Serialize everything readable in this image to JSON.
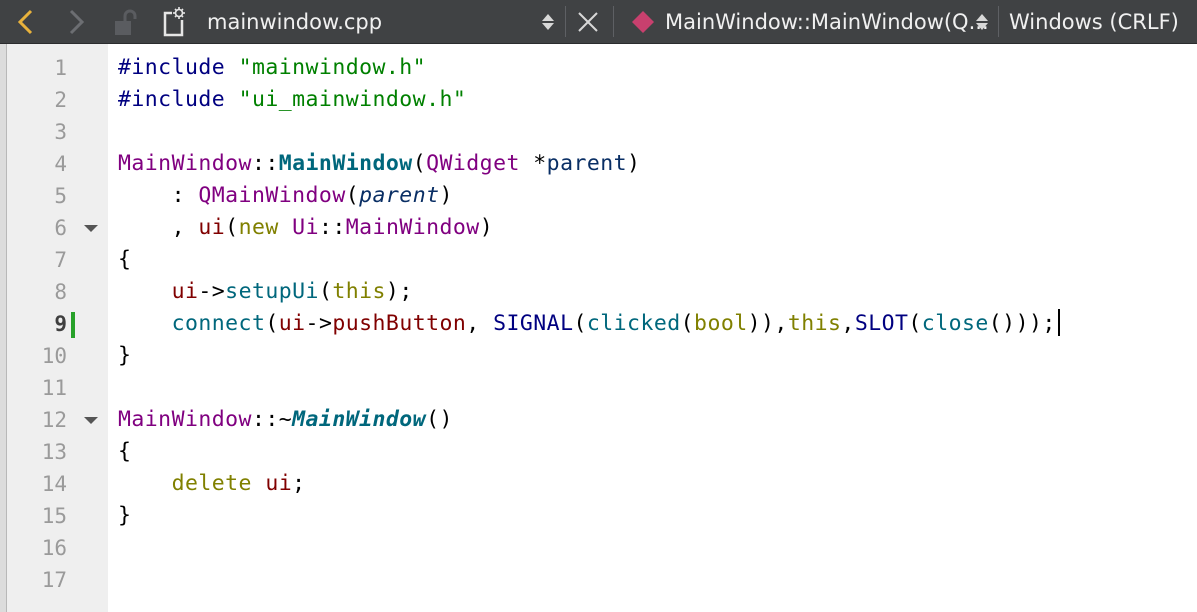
{
  "toolbar": {
    "file_name": "mainwindow.cpp",
    "symbol": "MainWindow::MainWindow(Q...",
    "line_endings": "Windows (CRLF)",
    "colors": {
      "background": "#404244",
      "symbol_icon": "#c8406e"
    },
    "icons": [
      "back-arrow-icon",
      "forward-arrow-icon",
      "lock-icon",
      "file-icon",
      "select-arrows-icon",
      "close-icon",
      "symbol-icon",
      "select-arrows-icon"
    ]
  },
  "editor": {
    "current_line": "9",
    "line_numbers": [
      "1",
      "2",
      "3",
      "4",
      "5",
      "6",
      "7",
      "8",
      "9",
      "10",
      "11",
      "12",
      "13",
      "14",
      "15",
      "16",
      "17"
    ],
    "fold_markers": [
      "6",
      "12"
    ],
    "lines": [
      [
        [
          "pp",
          "#include"
        ],
        [
          "op",
          " "
        ],
        [
          "str",
          "\"mainwindow.h\""
        ]
      ],
      [
        [
          "pp",
          "#include"
        ],
        [
          "op",
          " "
        ],
        [
          "str",
          "\"ui_mainwindow.h\""
        ]
      ],
      [],
      [
        [
          "type",
          "MainWindow"
        ],
        [
          "op",
          "::"
        ],
        [
          "decl",
          "MainWindow"
        ],
        [
          "op",
          "("
        ],
        [
          "type",
          "QWidget"
        ],
        [
          "op",
          " *"
        ],
        [
          "param",
          "parent"
        ],
        [
          "op",
          ")"
        ]
      ],
      [
        [
          "op",
          "    : "
        ],
        [
          "type",
          "QMainWindow"
        ],
        [
          "op",
          "("
        ],
        [
          "param-it",
          "parent"
        ],
        [
          "op",
          ")"
        ]
      ],
      [
        [
          "op",
          "    , "
        ],
        [
          "field",
          "ui"
        ],
        [
          "op",
          "("
        ],
        [
          "kw",
          "new"
        ],
        [
          "op",
          " "
        ],
        [
          "type",
          "Ui"
        ],
        [
          "op",
          "::"
        ],
        [
          "type",
          "MainWindow"
        ],
        [
          "op",
          ")"
        ]
      ],
      [
        [
          "op",
          "{"
        ]
      ],
      [
        [
          "op",
          "    "
        ],
        [
          "field",
          "ui"
        ],
        [
          "op",
          "->"
        ],
        [
          "func",
          "setupUi"
        ],
        [
          "op",
          "("
        ],
        [
          "kw",
          "this"
        ],
        [
          "op",
          ");"
        ]
      ],
      [
        [
          "op",
          "    "
        ],
        [
          "func",
          "connect"
        ],
        [
          "op",
          "("
        ],
        [
          "field",
          "ui"
        ],
        [
          "op",
          "->"
        ],
        [
          "field",
          "pushButton"
        ],
        [
          "op",
          ", "
        ],
        [
          "macro",
          "SIGNAL"
        ],
        [
          "op",
          "("
        ],
        [
          "func",
          "clicked"
        ],
        [
          "op",
          "("
        ],
        [
          "kw",
          "bool"
        ],
        [
          "op",
          "))"
        ],
        [
          "op",
          ","
        ],
        [
          "kw",
          "this"
        ],
        [
          "op",
          ","
        ],
        [
          "macro",
          "SLOT"
        ],
        [
          "op",
          "("
        ],
        [
          "func",
          "close"
        ],
        [
          "op",
          "()));"
        ]
      ],
      [
        [
          "op",
          "}"
        ]
      ],
      [],
      [
        [
          "type",
          "MainWindow"
        ],
        [
          "op",
          "::~"
        ],
        [
          "decl-it",
          "MainWindow"
        ],
        [
          "op",
          "()"
        ]
      ],
      [
        [
          "op",
          "{"
        ]
      ],
      [
        [
          "op",
          "    "
        ],
        [
          "kw",
          "delete"
        ],
        [
          "op",
          " "
        ],
        [
          "field",
          "ui"
        ],
        [
          "op",
          ";"
        ]
      ],
      [
        [
          "op",
          "}"
        ]
      ],
      [],
      []
    ]
  }
}
